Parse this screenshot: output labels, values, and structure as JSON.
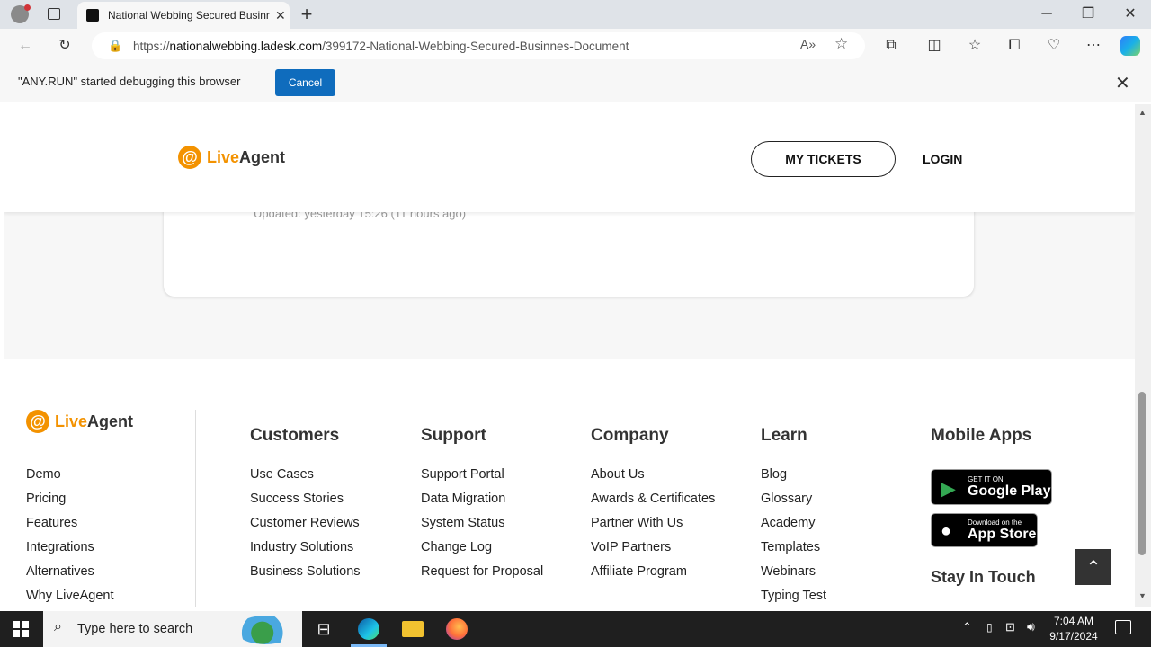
{
  "browser": {
    "tab_title": "National Webbing Secured Businnes",
    "url_prefix": "https://",
    "url_host": "nationalwebbing.ladesk.com",
    "url_path": "/399172-National-Webbing-Secured-Businnes-Document",
    "debug_message": "\"ANY.RUN\" started debugging this browser",
    "cancel_label": "Cancel"
  },
  "header": {
    "logo_live": "Live",
    "logo_agent": "Agent",
    "my_tickets": "MY TICKETS",
    "login": "LOGIN"
  },
  "card": {
    "updated": "Updated: yesterday 15:26 (11 hours ago)"
  },
  "footer": {
    "brand": {
      "logo_live": "Live",
      "logo_agent": "Agent",
      "links": [
        "Demo",
        "Pricing",
        "Features",
        "Integrations",
        "Alternatives",
        "Why LiveAgent"
      ]
    },
    "customers": {
      "title": "Customers",
      "links": [
        "Use Cases",
        "Success Stories",
        "Customer Reviews",
        "Industry Solutions",
        "Business Solutions"
      ]
    },
    "support": {
      "title": "Support",
      "links": [
        "Support Portal",
        "Data Migration",
        "System Status",
        "Change Log",
        "Request for Proposal"
      ]
    },
    "company": {
      "title": "Company",
      "links": [
        "About Us",
        "Awards & Certificates",
        "Partner With Us",
        "VoIP Partners",
        "Affiliate Program"
      ]
    },
    "learn": {
      "title": "Learn",
      "links": [
        "Blog",
        "Glossary",
        "Academy",
        "Templates",
        "Webinars",
        "Typing Test"
      ]
    },
    "mobile": {
      "title": "Mobile Apps",
      "google_small": "GET IT ON",
      "google_large": "Google Play",
      "apple_small": "Download on the",
      "apple_large": "App Store",
      "stay_in_touch": "Stay In Touch"
    }
  },
  "taskbar": {
    "search_placeholder": "Type here to search",
    "time": "7:04 AM",
    "date": "9/17/2024"
  }
}
